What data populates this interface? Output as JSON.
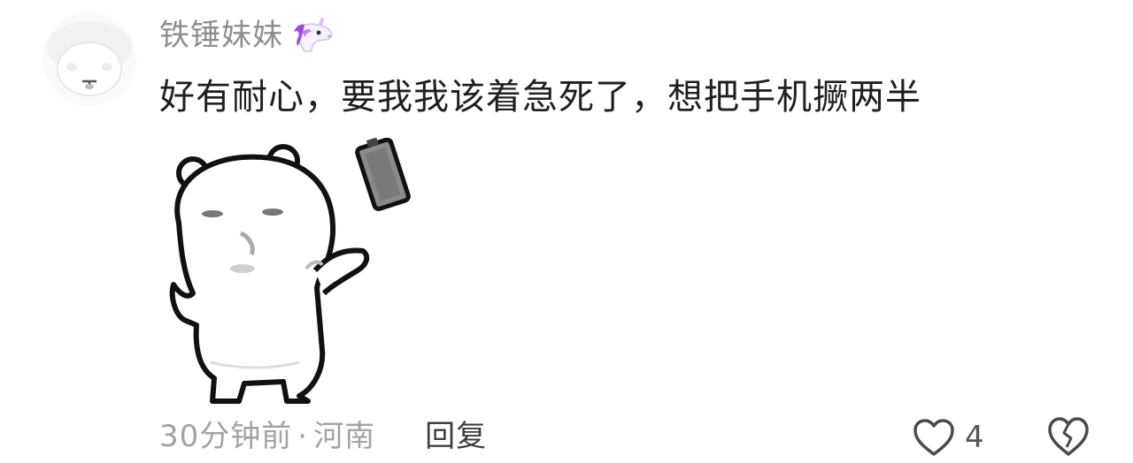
{
  "comment": {
    "username": "铁锤妹妹",
    "badge_icon": "unicorn-icon",
    "text": "好有耐心，要我我该着急死了，想把手机撅两半",
    "sticker_icon": "bear-throwing-phone-icon",
    "time": "30分钟前",
    "separator": "·",
    "location": "河南",
    "reply_label": "回复",
    "like_count": "4"
  },
  "icons": {
    "like": "heart-outline-icon",
    "dislike": "broken-heart-icon"
  },
  "colors": {
    "text_primary": "#1f1f1f",
    "username": "#8e8e8e",
    "meta": "#a3a3a3",
    "reply": "#3d3d3d"
  }
}
